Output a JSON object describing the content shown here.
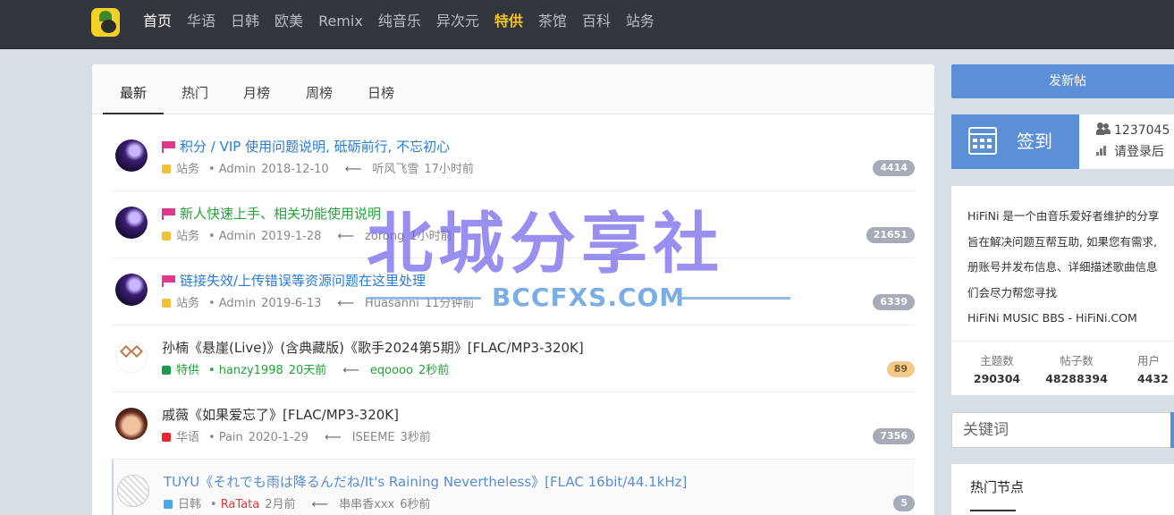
{
  "nav": {
    "items": [
      {
        "label": "首页",
        "state": "active"
      },
      {
        "label": "华语"
      },
      {
        "label": "日韩"
      },
      {
        "label": "欧美"
      },
      {
        "label": "Remix"
      },
      {
        "label": "纯音乐"
      },
      {
        "label": "异次元"
      },
      {
        "label": "特供",
        "state": "special"
      },
      {
        "label": "茶馆"
      },
      {
        "label": "百科"
      },
      {
        "label": "站务"
      }
    ]
  },
  "tabs": [
    "最新",
    "热门",
    "月榜",
    "周榜",
    "日榜"
  ],
  "threads": [
    {
      "title": "积分 / VIP 使用问题说明, 砥砺前行, 不忘初心",
      "pinned": true,
      "forum": "站务",
      "forum_color": "#f0c23b",
      "author": "Admin",
      "date": "2018-12-10",
      "last_user": "听风飞雪",
      "last_time": "17小时前",
      "replies": "4414"
    },
    {
      "title": "新人快速上手、相关功能使用说明",
      "pinned": true,
      "forum": "站务",
      "forum_color": "#f0c23b",
      "author": "Admin",
      "date": "2019-1-28",
      "last_user": "zorong",
      "last_time": "1小时前",
      "replies": "21651"
    },
    {
      "title": "链接失效/上传错误等资源问题在这里处理",
      "pinned": true,
      "forum": "站务",
      "forum_color": "#f0c23b",
      "author": "Admin",
      "date": "2019-6-13",
      "last_user": "Huasanni",
      "last_time": "11分钟前",
      "replies": "6339"
    },
    {
      "title": "孙楠《悬崖(Live)》(含典藏版)《歌手2024第5期》[FLAC/MP3-320K]",
      "pinned": false,
      "forum": "特供",
      "forum_color": "#1e9a4b",
      "author": "hanzy1998",
      "date": "20天前",
      "last_user": "eqoooo",
      "last_time": "2秒前",
      "replies": "89"
    },
    {
      "title": "戚薇《如果爱忘了》[FLAC/MP3-320K]",
      "pinned": false,
      "forum": "华语",
      "forum_color": "#e8262f",
      "author": "Pain",
      "date": "2020-1-29",
      "last_user": "ISEEME",
      "last_time": "3秒前",
      "replies": "7356"
    },
    {
      "title": "TUYU《それでも雨は降るんだね/It's Raining Nevertheless》[FLAC 16bit/44.1kHz]",
      "pinned": false,
      "forum": "日韩",
      "forum_color": "#4aa7e8",
      "author": "RaTata",
      "date": "2月前",
      "last_user": "串串香xxx",
      "last_time": "6秒前",
      "replies": "5"
    }
  ],
  "sidebar": {
    "post_button": "发新帖",
    "signin_label": "签到",
    "user_count": "1237045",
    "login_hint": "请登录后",
    "about_lines": [
      "HiFiNi 是一个由音乐爱好者维护的分享",
      "旨在解决问题互帮互助, 如果您有需求,",
      "册账号并发布信息、详细描述歌曲信息",
      "们会尽力帮您寻找",
      "HiFiNi MUSIC BBS - HiFiNi.COM"
    ],
    "stats": [
      {
        "label": "主题数",
        "value": "290304"
      },
      {
        "label": "帖子数",
        "value": "48288394"
      },
      {
        "label": "用户",
        "value": "4432"
      }
    ],
    "search_placeholder": "关键词",
    "hot_title": "热门节点"
  },
  "watermark": {
    "big": "北城分享社",
    "small": "BCCFXS.COM"
  },
  "colors": {
    "nav_bg": "#33373d",
    "accent": "#5b8fd6",
    "special": "#f0c02b"
  }
}
